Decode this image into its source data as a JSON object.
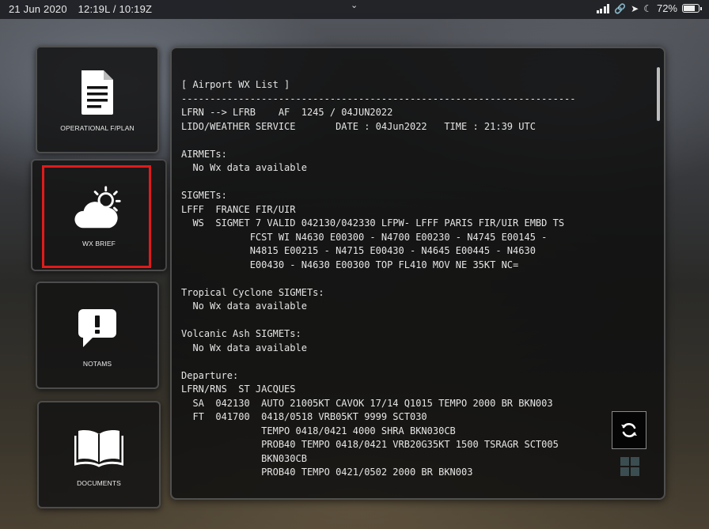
{
  "status_bar": {
    "date": "21 Jun 2020",
    "time": "12:19L / 10:19Z",
    "battery": "72%"
  },
  "sidebar": {
    "items": [
      {
        "label": "OPERATIONAL F/PLAN",
        "icon": "document-icon"
      },
      {
        "label": "WX BRIEF",
        "icon": "weather-icon",
        "selected": true
      },
      {
        "label": "NOTAMS",
        "icon": "alert-bubble-icon"
      },
      {
        "label": "DOCUMENTS",
        "icon": "book-icon"
      }
    ],
    "highlight_color": "#e11a1a"
  },
  "wx": {
    "lines": [
      "[ Airport WX List ]",
      "---------------------------------------------------------------------",
      "LFRN --> LFRB    AF  1245 / 04JUN2022",
      "LIDO/WEATHER SERVICE       DATE : 04Jun2022   TIME : 21:39 UTC",
      "",
      "AIRMETs:",
      "  No Wx data available",
      "",
      "SIGMETs:",
      "LFFF  FRANCE FIR/UIR",
      "  WS  SIGMET 7 VALID 042130/042330 LFPW- LFFF PARIS FIR/UIR EMBD TS",
      "            FCST WI N4630 E00300 - N4700 E00230 - N4745 E00145 -",
      "            N4815 E00215 - N4715 E00430 - N4645 E00445 - N4630",
      "            E00430 - N4630 E00300 TOP FL410 MOV NE 35KT NC=",
      "",
      "Tropical Cyclone SIGMETs:",
      "  No Wx data available",
      "",
      "Volcanic Ash SIGMETs:",
      "  No Wx data available",
      "",
      "Departure:",
      "LFRN/RNS  ST JACQUES",
      "  SA  042130  AUTO 21005KT CAVOK 17/14 Q1015 TEMPO 2000 BR BKN003",
      "  FT  041700  0418/0518 VRB05KT 9999 SCT030",
      "              TEMPO 0418/0421 4000 SHRA BKN030CB",
      "              PROB40 TEMPO 0418/0421 VRB20G35KT 1500 TSRAGR SCT005",
      "              BKN030CB",
      "              PROB40 TEMPO 0421/0502 2000 BR BKN003"
    ]
  },
  "controls": {
    "refresh_icon": "refresh-icon",
    "grid_icon": "grid-icon"
  }
}
